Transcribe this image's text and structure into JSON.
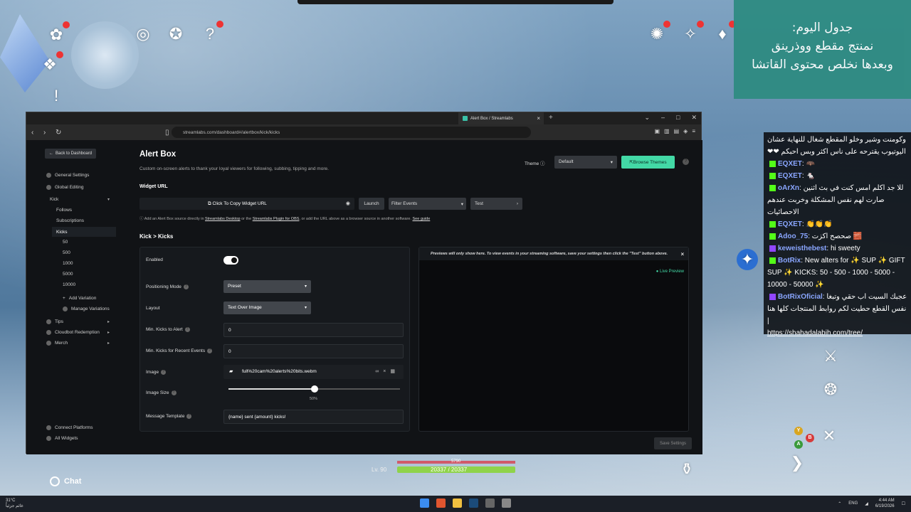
{
  "schedule": {
    "line1": "جدول اليوم:",
    "line2": "نمنتج مقطع ووذرينق",
    "line3": "وبعدها نخلص محتوى القاتشا"
  },
  "chat": {
    "messages": [
      {
        "user": "",
        "text": "وكومنت وشير وخلو المقطع شغال للنهاية عشان اليوتيوب يقترحه على ناس اكثر وبس احبكم ❤❤"
      },
      {
        "user": "EQXET",
        "text": "🦇"
      },
      {
        "user": "EQXET",
        "text": "🐁"
      },
      {
        "user": "oArXn",
        "text": "للا جد اكلم امس كنت في بث اثنين صارت لهم نفس المشكلة وخربت عندهم الاحصائيات"
      },
      {
        "user": "EQXET",
        "text": "👏👏👏"
      },
      {
        "user": "Adoo_75",
        "text": "صحصح اكزت 🧱"
      },
      {
        "user": "keweisthebest",
        "text": "hi sweety"
      },
      {
        "user": "BotRix",
        "text": "New alters for ✨ SUP ✨ GIFT SUP ✨ KICKS: 50 - 500 - 1000 - 5000 - 10000 - 50000 ✨"
      },
      {
        "user": "BotRixOficial",
        "text": "عجبك السيت اب حقي وتبغا نفس القطع حطيت لكم روابط المنتجات كلها هنا |"
      },
      {
        "user": "",
        "text": "https://shahadalabih.com/tree/"
      }
    ]
  },
  "browser": {
    "tab_title": "Alert Box / Streamlabs",
    "url": "streamlabs.com/dashboard#/alertbox/kick/kicks"
  },
  "sidebar": {
    "back": "Back to Dashboard",
    "general_settings": "General Settings",
    "global_editing": "Global Editing",
    "kick": "Kick",
    "follows": "Follows",
    "subscriptions": "Subscriptions",
    "kicks": "Kicks",
    "variations": [
      "50",
      "500",
      "1000",
      "5000",
      "10000"
    ],
    "add_variation": "Add Variation",
    "manage_variations": "Manage Variations",
    "tips": "Tips",
    "cloudbot": "Cloudbot Redemption",
    "merch": "Merch",
    "connect_platforms": "Connect Platforms",
    "all_widgets": "All Widgets"
  },
  "main": {
    "title": "Alert Box",
    "subtitle": "Custom on-screen alerts to thank your loyal viewers for following, subbing, tipping and more.",
    "theme_label": "Theme",
    "theme_value": "Default",
    "browse_themes": "Browse Themes",
    "widget_url_label": "Widget URL",
    "copy_widget_url": "Click To Copy Widget URL",
    "launch": "Launch",
    "filter_events": "Filter Events",
    "test": "Test",
    "hint_a": "Add an Alert Box source directly in ",
    "hint_link1": "Streamlabs Desktop",
    "hint_b": " or the ",
    "hint_link2": "Streamlabs Plugin for OBS",
    "hint_c": ", or add the URL above as a browser source in another software. ",
    "hint_link3": "See guide",
    "section": "Kick > Kicks",
    "enabled": "Enabled",
    "positioning_mode": "Positioning Mode",
    "positioning_value": "Preset",
    "layout": "Layout",
    "layout_value": "Text Over Image",
    "min_kicks_alert": "Min. Kicks to Alert",
    "min_kicks_alert_value": "0",
    "min_kicks_recent": "Min. Kicks for Recent Events",
    "min_kicks_recent_value": "0",
    "image": "Image",
    "image_file": "full%20cam%20alerts%20bits.webm",
    "image_size": "Image Size",
    "image_size_value": "50%",
    "image_size_fraction": 0.5,
    "message_template": "Message Template",
    "message_template_value": "{name} sent {amount} kicks!",
    "preview_note": "Previews will only show here. To view events in your streaming software, save your settings then click the \"Test\" button above.",
    "live_preview": "● Live Preview",
    "save_settings": "Save Settings"
  },
  "hud": {
    "chat": "Chat",
    "level": "Lv. 90",
    "hp": "20337 / 20337",
    "shield": "5790",
    "hp_fraction": 1.0
  },
  "taskbar": {
    "temp": "31°C",
    "weather": "غائم جزئياً",
    "lang": "ENG",
    "time": "4:44 AM",
    "date": "6/19/2026"
  }
}
